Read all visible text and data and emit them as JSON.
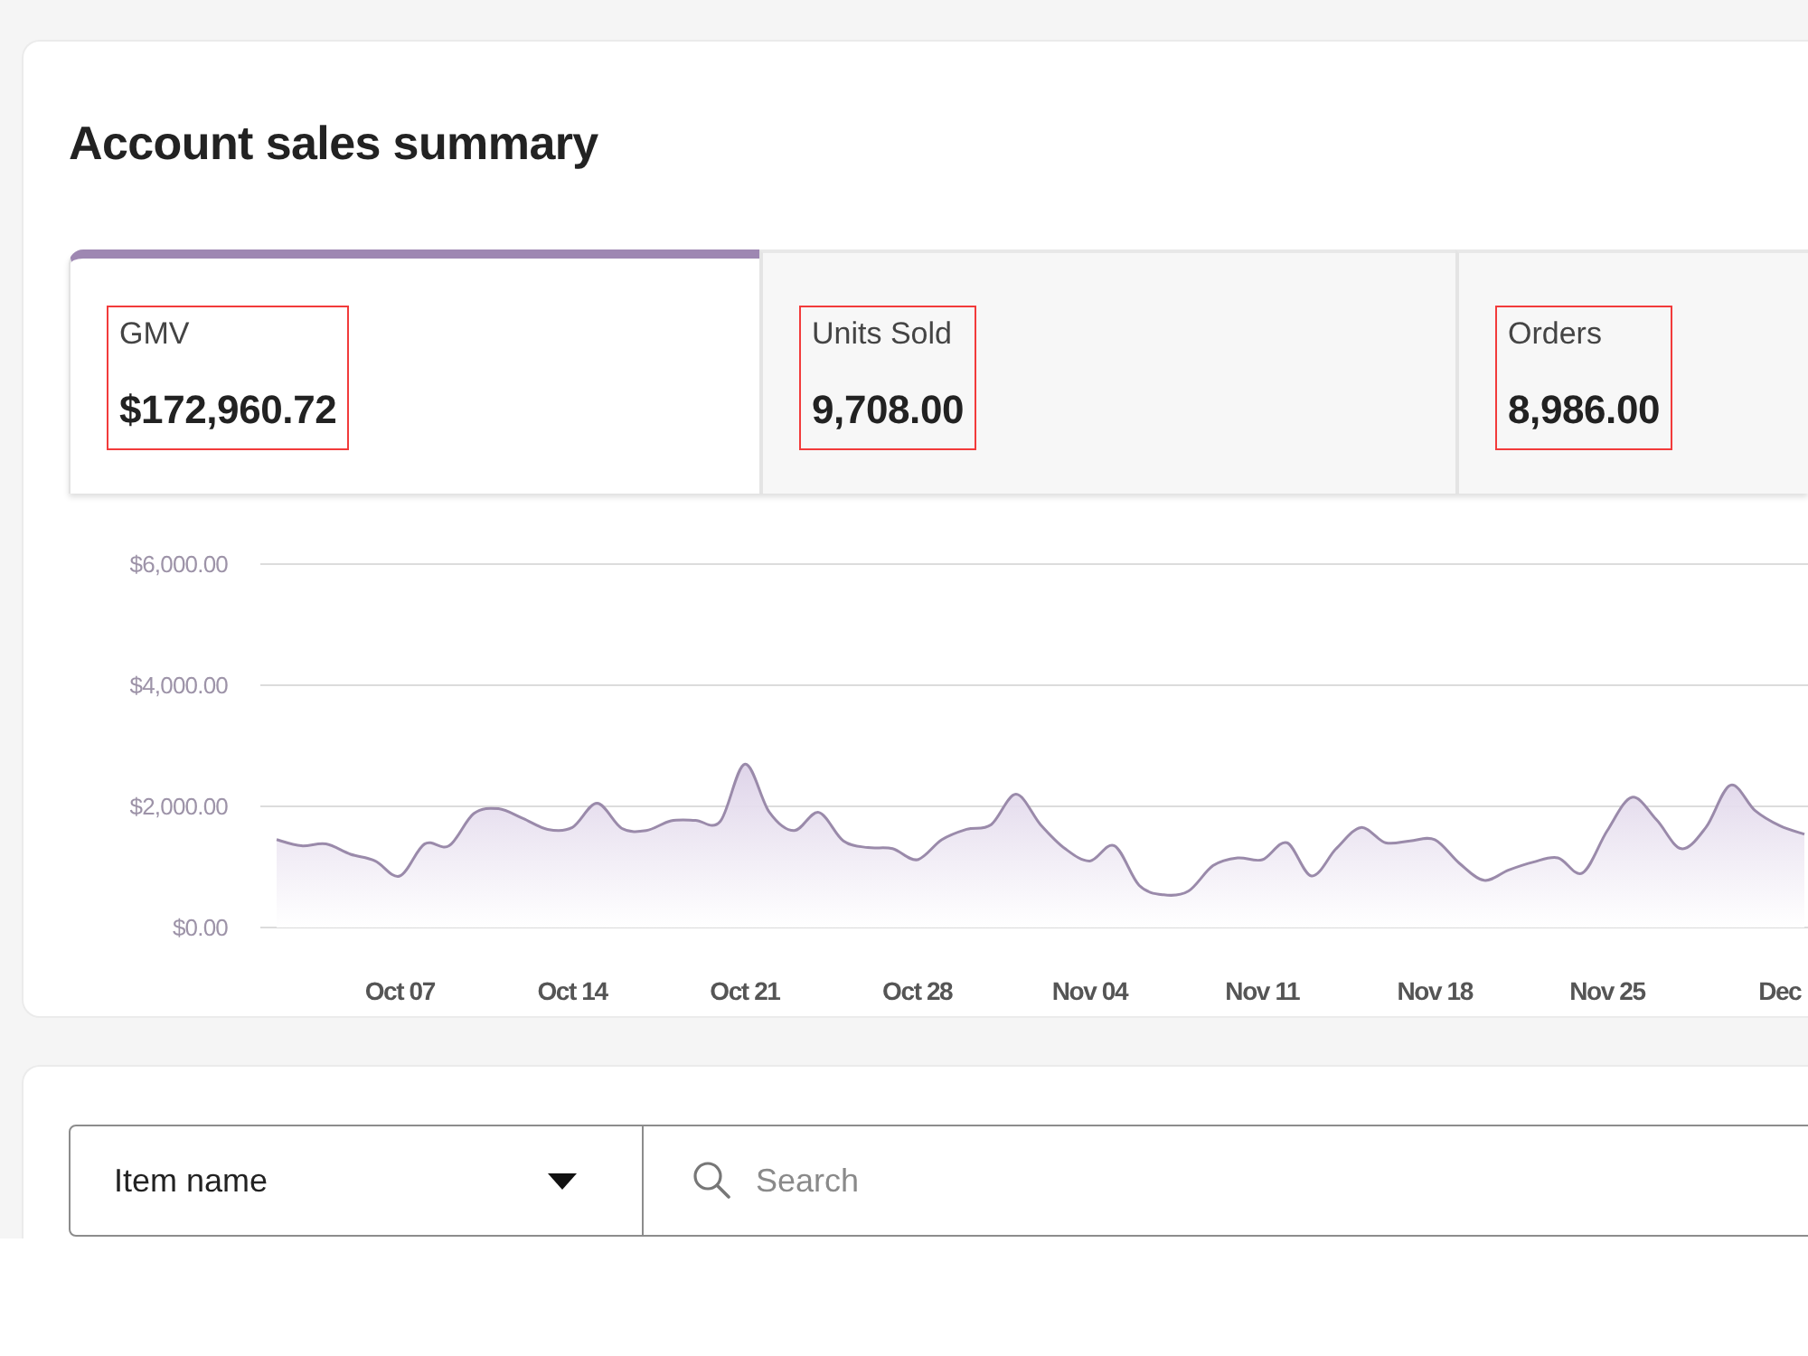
{
  "card": {
    "title": "Account sales summary",
    "metrics": [
      {
        "label": "GMV",
        "value": "$172,960.72",
        "selected": true,
        "highlighted": true
      },
      {
        "label": "Units Sold",
        "value": "9,708.00",
        "selected": false,
        "highlighted": true
      },
      {
        "label": "Orders",
        "value": "8,986.00",
        "selected": false,
        "highlighted": true
      }
    ],
    "chart_data": {
      "type": "area",
      "categories": [
        null,
        null,
        null,
        null,
        null,
        "Oct 07",
        null,
        null,
        null,
        null,
        null,
        null,
        "Oct 14",
        null,
        null,
        null,
        null,
        null,
        null,
        "Oct 21",
        null,
        null,
        null,
        null,
        null,
        null,
        "Oct 28",
        null,
        null,
        null,
        null,
        null,
        null,
        "Nov 04",
        null,
        null,
        null,
        null,
        null,
        null,
        "Nov 11",
        null,
        null,
        null,
        null,
        null,
        null,
        "Nov 18",
        null,
        null,
        null,
        null,
        null,
        null,
        "Nov 25",
        null,
        null,
        null,
        null,
        null,
        null,
        "Dec",
        null
      ],
      "series": [
        {
          "color": "#9a8aaa",
          "values": [
            1450,
            1350,
            1380,
            1210,
            1100,
            850,
            1380,
            1350,
            1880,
            1960,
            1800,
            1620,
            1650,
            2050,
            1640,
            1600,
            1760,
            1770,
            1750,
            2700,
            1900,
            1600,
            1900,
            1430,
            1320,
            1300,
            1120,
            1450,
            1620,
            1700,
            2200,
            1700,
            1300,
            1100,
            1350,
            700,
            540,
            600,
            1020,
            1150,
            1120,
            1400,
            850,
            1300,
            1650,
            1400,
            1430,
            1450,
            1060,
            780,
            950,
            1080,
            1150,
            900,
            1600,
            2150,
            1780,
            1300,
            1650,
            2350,
            1930,
            1680,
            1540
          ]
        }
      ],
      "ylim": [
        0,
        6000
      ],
      "yticks": [
        {
          "value": 0,
          "label": "$0.00"
        },
        {
          "value": 2000,
          "label": "$2,000.00"
        },
        {
          "value": 4000,
          "label": "$4,000.00"
        },
        {
          "value": 6000,
          "label": "$6,000.00"
        }
      ]
    }
  },
  "filter_bar": {
    "dropdown": {
      "value": "Item name"
    },
    "search": {
      "placeholder": "Search"
    }
  }
}
